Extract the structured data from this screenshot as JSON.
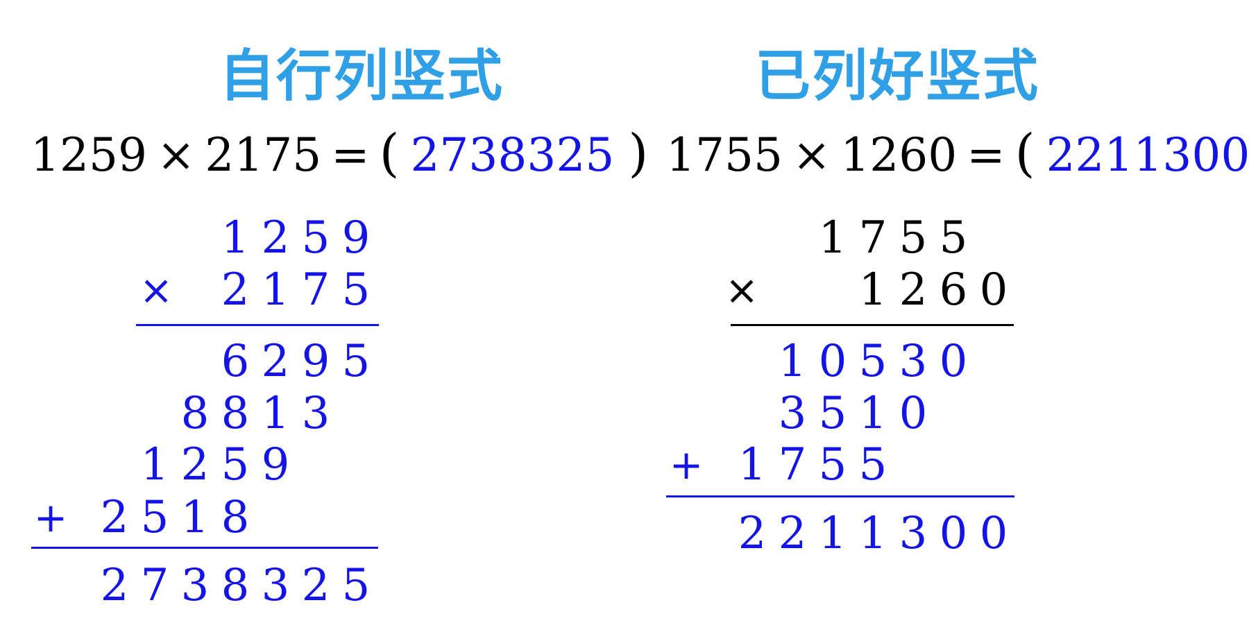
{
  "colors": {
    "heading": "#2f9fe6",
    "answer": "#1414e6",
    "text": "#000000"
  },
  "left": {
    "heading": "自行列竖式",
    "equation": {
      "a": "1259",
      "op": "×",
      "b": "2175",
      "eq": "=",
      "open": "(",
      "answer": "2738325",
      "close": ")"
    },
    "multiplicand": "1259",
    "multiplier": "2175",
    "times_sign": "×",
    "plus_sign": "+",
    "partials": [
      "6295",
      "8813",
      "1259",
      "2518"
    ],
    "result": "2738325"
  },
  "right": {
    "heading": "已列好竖式",
    "equation": {
      "a": "1755",
      "op": "×",
      "b": "1260",
      "eq": "=",
      "open": "(",
      "answer": "2211300",
      "close": ")"
    },
    "multiplicand": "1755",
    "multiplier": "1260",
    "times_sign": "×",
    "plus_sign": "+",
    "partials": [
      "10530",
      "3510",
      "1755"
    ],
    "result": "2211300"
  }
}
